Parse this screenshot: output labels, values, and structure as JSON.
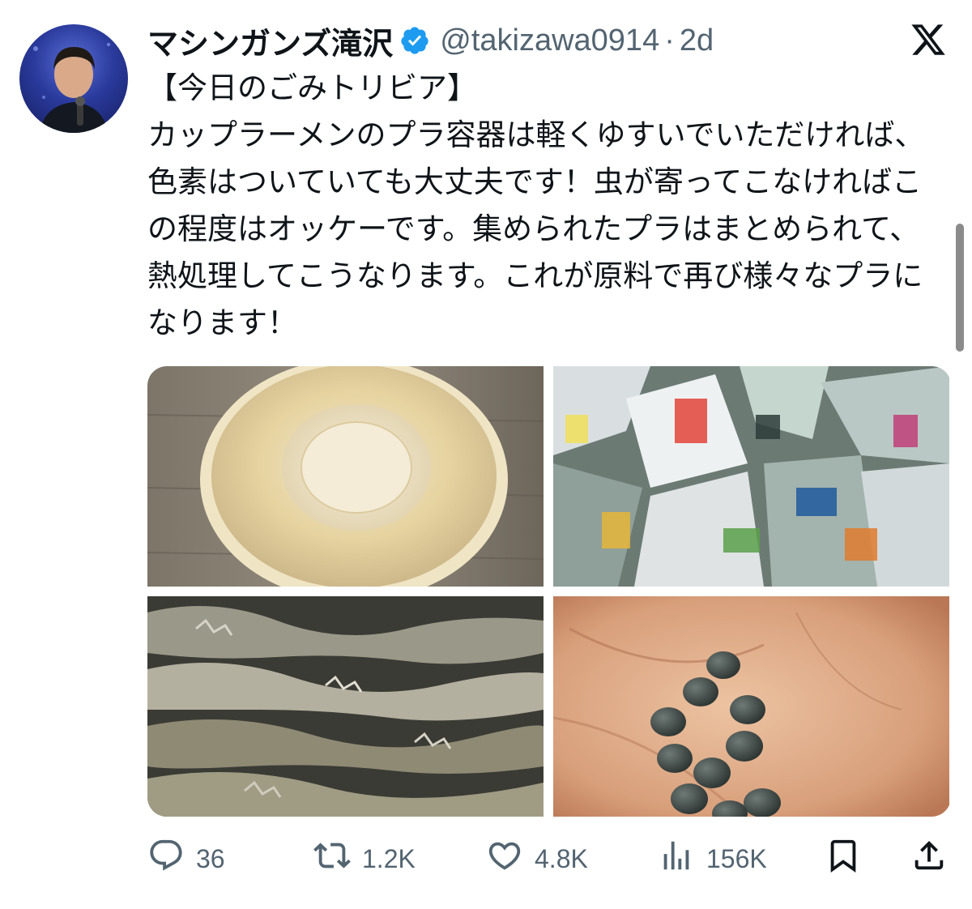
{
  "author": {
    "display_name": "マシンガンズ滝沢",
    "handle": "@takizawa0914",
    "separator": "·",
    "time": "2d"
  },
  "icons": {
    "verified": "verified-badge-icon",
    "platform": "x-logo-icon",
    "reply": "reply-icon",
    "repost": "repost-icon",
    "like": "like-icon",
    "views": "views-icon",
    "bookmark": "bookmark-icon",
    "share": "share-icon"
  },
  "tweet": {
    "text": "【今日のごみトリビア】\nカップラーメンのプラ容器は軽くゆすいでいただければ、色素はついていても大丈夫です！虫が寄ってこなければこの程度はオッケーです。集められたプラはまとめられて、熱処理してこうなります。これが原料で再び様々なプラになります！"
  },
  "media": [
    {
      "name": "cup-noodle-container-photo"
    },
    {
      "name": "collected-plastic-waste-photo"
    },
    {
      "name": "heat-processed-plastic-photo"
    },
    {
      "name": "recycled-plastic-pellets-photo"
    }
  ],
  "stats": {
    "replies": "36",
    "reposts": "1.2K",
    "likes": "4.8K",
    "views": "156K"
  },
  "colors": {
    "text": "#0f1419",
    "secondary": "#536471",
    "verified": "#1d9bf0"
  }
}
